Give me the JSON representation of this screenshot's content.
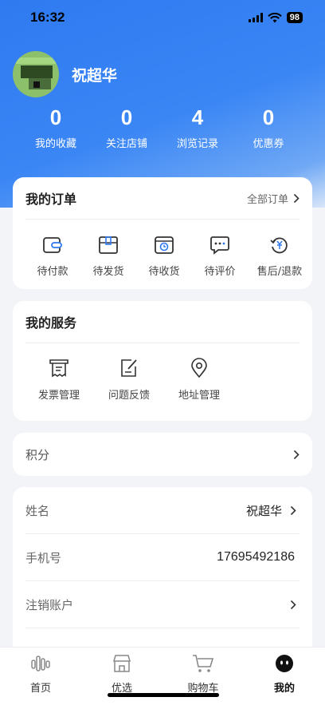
{
  "status_bar": {
    "time": "16:32",
    "battery": "98"
  },
  "profile": {
    "name": "祝超华"
  },
  "stats": [
    {
      "value": "0",
      "label": "我的收藏"
    },
    {
      "value": "0",
      "label": "关注店铺"
    },
    {
      "value": "4",
      "label": "浏览记录"
    },
    {
      "value": "0",
      "label": "优惠券"
    }
  ],
  "orders": {
    "title": "我的订单",
    "all_label": "全部订单",
    "items": [
      {
        "label": "待付款",
        "icon": "wallet-icon"
      },
      {
        "label": "待发货",
        "icon": "package-icon"
      },
      {
        "label": "待收货",
        "icon": "delivery-box-icon"
      },
      {
        "label": "待评价",
        "icon": "comment-icon"
      },
      {
        "label": "售后/退款",
        "icon": "refund-icon"
      }
    ]
  },
  "services": {
    "title": "我的服务",
    "items": [
      {
        "label": "发票管理",
        "icon": "receipt-icon"
      },
      {
        "label": "问题反馈",
        "icon": "edit-note-icon"
      },
      {
        "label": "地址管理",
        "icon": "location-pin-icon"
      }
    ]
  },
  "points": {
    "label": "积分"
  },
  "info": {
    "name_label": "姓名",
    "name_value": "祝超华",
    "phone_label": "手机号",
    "phone_value": "17695492186",
    "cancel_label": "注销账户"
  },
  "tabbar": [
    {
      "label": "首页",
      "icon": "home-waves-icon"
    },
    {
      "label": "优选",
      "icon": "store-icon"
    },
    {
      "label": "购物车",
      "icon": "cart-icon"
    },
    {
      "label": "我的",
      "icon": "profile-face-icon"
    }
  ],
  "colors": {
    "primary": "#2f7af0",
    "active_tab": "#111111",
    "inactive_tab": "#666666"
  }
}
